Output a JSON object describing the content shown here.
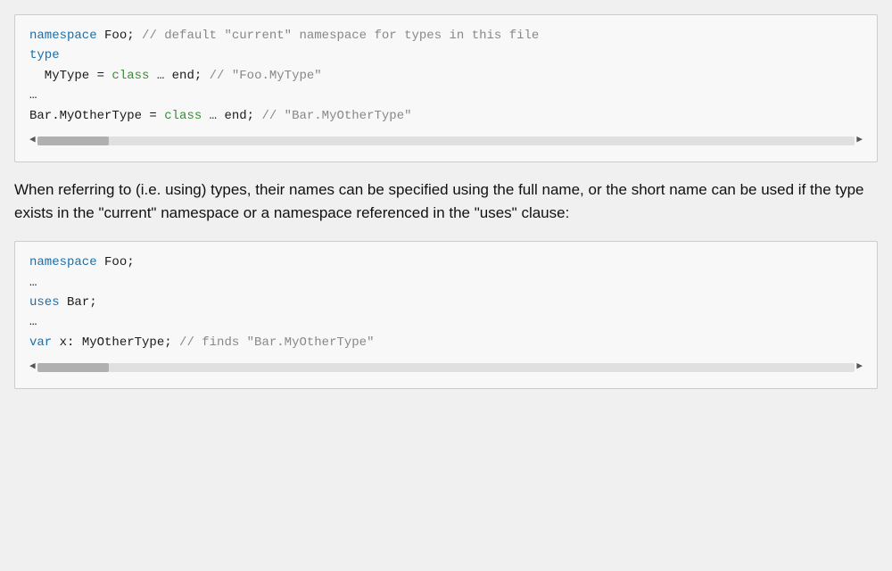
{
  "code_block_1": {
    "lines": [
      {
        "parts": [
          {
            "text": "namespace",
            "cls": "kw-blue"
          },
          {
            "text": " Foo; ",
            "cls": "id-dark"
          },
          {
            "text": "// default \"current\" namespace for types in this file",
            "cls": "comment"
          }
        ]
      },
      {
        "parts": [
          {
            "text": "",
            "cls": "id-dark"
          }
        ]
      },
      {
        "parts": [
          {
            "text": "type",
            "cls": "kw-blue"
          }
        ]
      },
      {
        "parts": [
          {
            "text": "  MyType = ",
            "cls": "id-dark"
          },
          {
            "text": "class",
            "cls": "kw-green"
          },
          {
            "text": " … end; ",
            "cls": "id-dark"
          },
          {
            "text": "// \"Foo.MyType\"",
            "cls": "comment"
          }
        ]
      },
      {
        "parts": [
          {
            "text": "…",
            "cls": "id-dark"
          }
        ]
      },
      {
        "parts": [
          {
            "text": "Bar.MyOtherType = ",
            "cls": "id-dark"
          },
          {
            "text": "class",
            "cls": "kw-green"
          },
          {
            "text": " … end; ",
            "cls": "id-dark"
          },
          {
            "text": "// \"Bar.MyOtherType\"",
            "cls": "comment"
          }
        ]
      }
    ]
  },
  "description": "When referring to (i.e. using) types, their names can be specified using the full name, or the short name can be used if the type exists in the \"current\" namespace or a namespace referenced in the \"uses\" clause:",
  "code_block_2": {
    "lines": [
      {
        "parts": [
          {
            "text": "namespace",
            "cls": "kw-blue"
          },
          {
            "text": " Foo;",
            "cls": "id-dark"
          }
        ]
      },
      {
        "parts": [
          {
            "text": "…",
            "cls": "id-dark"
          }
        ]
      },
      {
        "parts": [
          {
            "text": "uses",
            "cls": "kw-blue"
          },
          {
            "text": " Bar;",
            "cls": "id-dark"
          }
        ]
      },
      {
        "parts": [
          {
            "text": "…",
            "cls": "id-dark"
          }
        ]
      },
      {
        "parts": [
          {
            "text": "var",
            "cls": "kw-blue"
          },
          {
            "text": " x: MyOtherType; ",
            "cls": "id-dark"
          },
          {
            "text": "// finds \"Bar.MyOtherType\"",
            "cls": "comment"
          }
        ]
      }
    ]
  }
}
